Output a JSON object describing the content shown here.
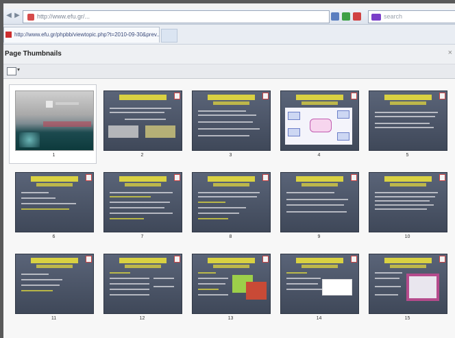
{
  "browser": {
    "address_url": "http://www.efu.gr/...",
    "tab_title": "http://www.efu.gr/phpbb/viewtopic.php?t=2010-09-30&prev...",
    "search_placeholder": "search"
  },
  "panel": {
    "title": "Page Thumbnails",
    "close_label": "×",
    "options_caret": "▾"
  },
  "pages": [
    {
      "num": "1"
    },
    {
      "num": "2"
    },
    {
      "num": "3"
    },
    {
      "num": "4"
    },
    {
      "num": "5"
    },
    {
      "num": "6"
    },
    {
      "num": "7"
    },
    {
      "num": "8"
    },
    {
      "num": "9"
    },
    {
      "num": "10"
    },
    {
      "num": "11"
    },
    {
      "num": "12"
    },
    {
      "num": "13"
    },
    {
      "num": "14"
    },
    {
      "num": "15"
    }
  ],
  "colors": {
    "slide_bg": "#4a5366",
    "slide_title": "#f0e53a",
    "selection_border": "#c7cbd1"
  }
}
